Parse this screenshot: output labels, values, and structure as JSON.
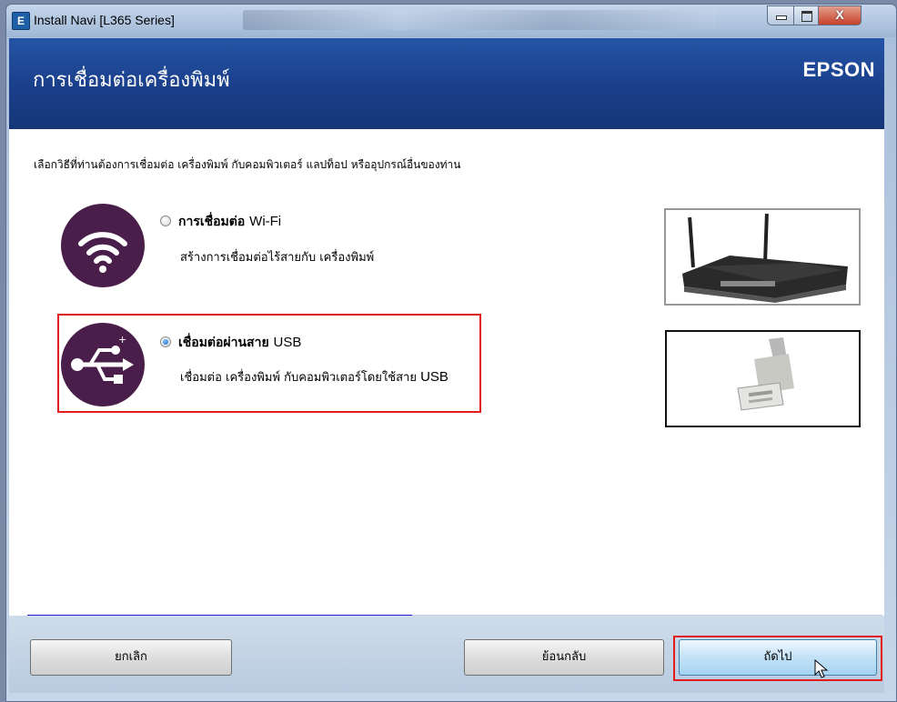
{
  "window": {
    "title": "Install Navi [L365 Series]",
    "close_glyph": "X"
  },
  "header": {
    "title": "การเชื่อมต่อเครื่องพิมพ์",
    "brand": "EPSON",
    "bg_color": "#1f4a9a"
  },
  "main": {
    "instruction": "เลือกวิธีที่ท่านต้องการเชื่อมต่อ เครื่องพิมพ์ กับคอมพิวเตอร์ แลปท็อป หรืออุปกรณ์อื่นของท่าน",
    "options": [
      {
        "icon": "wifi-icon",
        "title": "การเชื่อมต่อ",
        "title_suffix": "Wi-Fi",
        "description": "สร้างการเชื่อมต่อไร้สายกับ เครื่องพิมพ์",
        "selected": false,
        "image": "wireless-router-photo"
      },
      {
        "icon": "usb-icon",
        "title": "เชื่อมต่อผ่านสาย",
        "title_suffix": "USB",
        "description": "เชื่อมต่อ เครื่องพิมพ์ กับคอมพิวเตอร์โดยใช้สาย",
        "description_suffix": "USB",
        "selected": true,
        "image": "usb-cable-photo"
      }
    ],
    "icon_color": "#4a1e4a",
    "highlight_color": "#e21b1b"
  },
  "progress": {
    "fraction": 0.45,
    "fill_color": "#1c1cd8",
    "track_color": "#c9c9f0"
  },
  "footer": {
    "cancel_label": "ยกเลิก",
    "back_label": "ย้อนกลับ",
    "next_label": "ถัดไป"
  }
}
